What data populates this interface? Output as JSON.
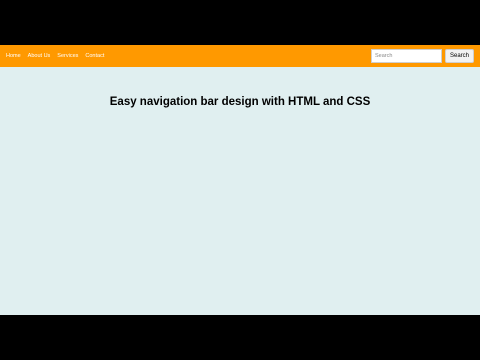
{
  "colors": {
    "navbar_background": "#ff9900",
    "page_background": "#e0eff0",
    "letterbox": "#000000",
    "nav_text": "#ffffff"
  },
  "navbar": {
    "links": [
      {
        "label": "Home"
      },
      {
        "label": "About Us"
      },
      {
        "label": "Services"
      },
      {
        "label": "Contact"
      }
    ],
    "search": {
      "placeholder": "Search",
      "value": "",
      "button_label": "Search"
    }
  },
  "main": {
    "title": "Easy navigation bar design with HTML and CSS"
  }
}
